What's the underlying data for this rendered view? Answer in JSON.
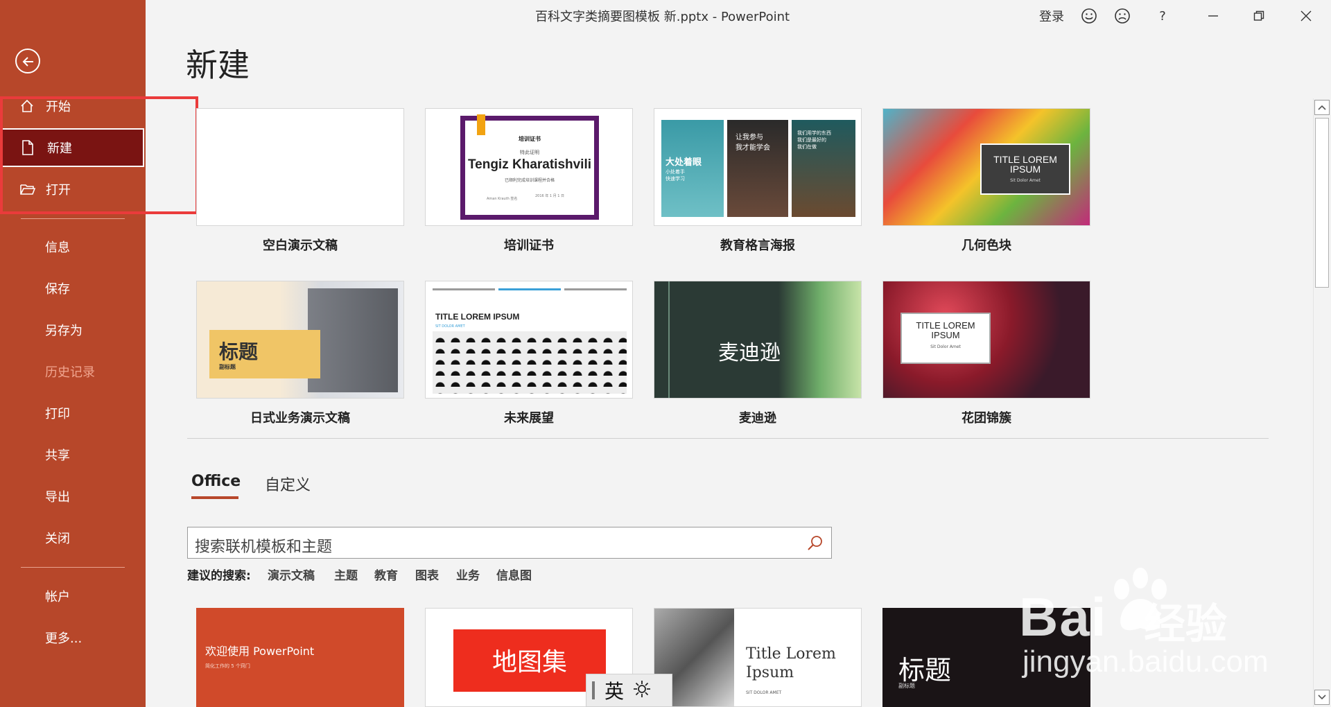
{
  "window": {
    "title": "百科文字类摘要图模板 新.pptx  -  PowerPoint",
    "signin": "登录",
    "help": "?"
  },
  "sidebar": {
    "items": [
      {
        "label": "开始",
        "icon": "home-icon"
      },
      {
        "label": "新建",
        "icon": "new-document-icon",
        "active": true
      },
      {
        "label": "打开",
        "icon": "open-folder-icon"
      },
      {
        "label": "信息"
      },
      {
        "label": "保存"
      },
      {
        "label": "另存为"
      },
      {
        "label": "历史记录",
        "disabled": true
      },
      {
        "label": "打印"
      },
      {
        "label": "共享"
      },
      {
        "label": "导出"
      },
      {
        "label": "关闭"
      },
      {
        "label": "帐户"
      },
      {
        "label": "更多..."
      }
    ]
  },
  "main": {
    "title": "新建",
    "featured": [
      {
        "label": "空白演示文稿"
      },
      {
        "label": "培训证书",
        "cert_heading": "培训证书",
        "cert_sub": "特此证明",
        "cert_name": "Tengiz Kharatishvili",
        "cert_line": "已顺利完成培训课程并合格",
        "cert_sign": "Aman Krauth 签名",
        "cert_date": "2016 年 1 月 1 日"
      },
      {
        "label": "教育格言海报",
        "panel1": "大处着眼",
        "panel1_sub": "小处着手\n快速学习",
        "panel2": "让我参与\n我才能学会",
        "panel3": "我们用学的东西\n我们是最好的\n我们在做"
      },
      {
        "label": "几何色块",
        "thumb_title": "TITLE LOREM IPSUM",
        "thumb_sub": "Sit Dolor Amet"
      },
      {
        "label": "日式业务演示文稿",
        "thumb_title": "标题",
        "thumb_sub": "副标题"
      },
      {
        "label": "未来展望",
        "thumb_title": "TITLE LOREM IPSUM",
        "thumb_sub": "SIT DOLOR AMET"
      },
      {
        "label": "麦迪逊",
        "thumb_title": "麦迪逊"
      },
      {
        "label": "花团锦簇",
        "thumb_title": "TITLE LOREM IPSUM",
        "thumb_sub": "Sit Dolor Amet"
      }
    ],
    "tabs": [
      {
        "label": "Office"
      },
      {
        "label": "自定义"
      }
    ],
    "search": {
      "placeholder": "搜索联机模板和主题"
    },
    "suggested": {
      "lead": "建议的搜索:",
      "items": [
        "演示文稿",
        "主题",
        "教育",
        "图表",
        "业务",
        "信息图"
      ]
    },
    "more_templates": [
      {
        "title": "欢迎使用 PowerPoint",
        "sub": "简化工作的 5 个窍门"
      },
      {
        "title": "地图集"
      },
      {
        "title": "Title Lorem Ipsum",
        "sub": "SIT DOLOR AMET"
      },
      {
        "title": "标题",
        "sub": "副标题"
      }
    ]
  },
  "ime": {
    "lang": "英"
  },
  "watermark": {
    "brand": "Bai",
    "brand_cn": "经验",
    "url": "jingyan.baidu.com"
  },
  "colors": {
    "accent": "#b7472a",
    "active": "#7a1412",
    "highlight": "#ea3b3b"
  }
}
